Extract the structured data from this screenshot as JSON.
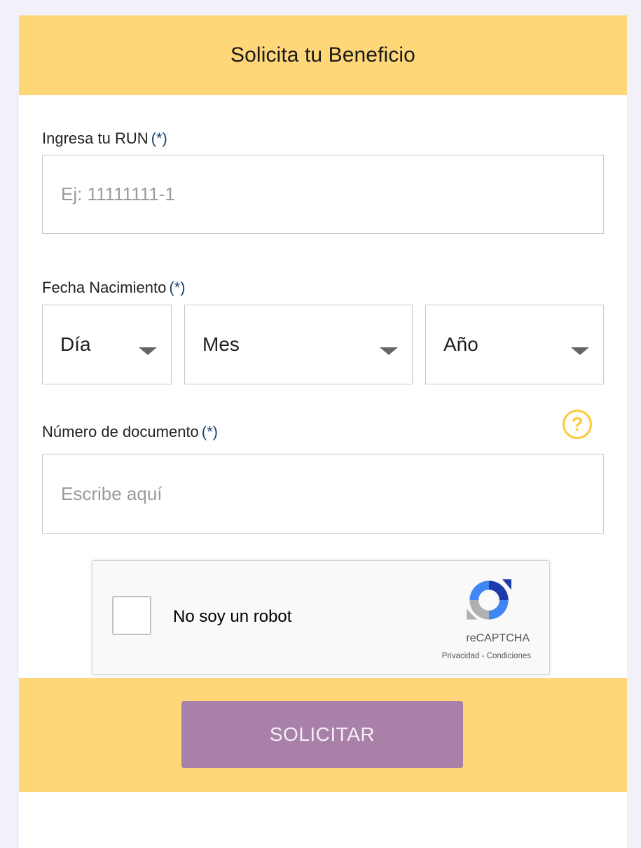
{
  "header": {
    "title": "Solicita tu Beneficio"
  },
  "run_field": {
    "label": "Ingresa tu RUN",
    "required_mark": "(*)",
    "placeholder": "Ej: 11111111-1",
    "value": ""
  },
  "birthdate": {
    "label": "Fecha Nacimiento",
    "required_mark": "(*)",
    "day": {
      "selected": "Día"
    },
    "month": {
      "selected": "Mes"
    },
    "year": {
      "selected": "Año"
    }
  },
  "document_field": {
    "label": "Número de documento",
    "required_mark": "(*)",
    "placeholder": "Escribe aquí",
    "value": "",
    "help_icon": "?"
  },
  "captcha": {
    "label": "No soy un robot",
    "brand": "reCAPTCHA",
    "privacy": "Privacidad",
    "separator": " - ",
    "terms": "Condiciones",
    "checked": false
  },
  "submit": {
    "label": "SOLICITAR"
  },
  "colors": {
    "accent_yellow": "#ffd778",
    "button_purple": "#a880a8",
    "required_blue": "#1c3f6e",
    "help_icon_yellow": "#ffc837"
  }
}
